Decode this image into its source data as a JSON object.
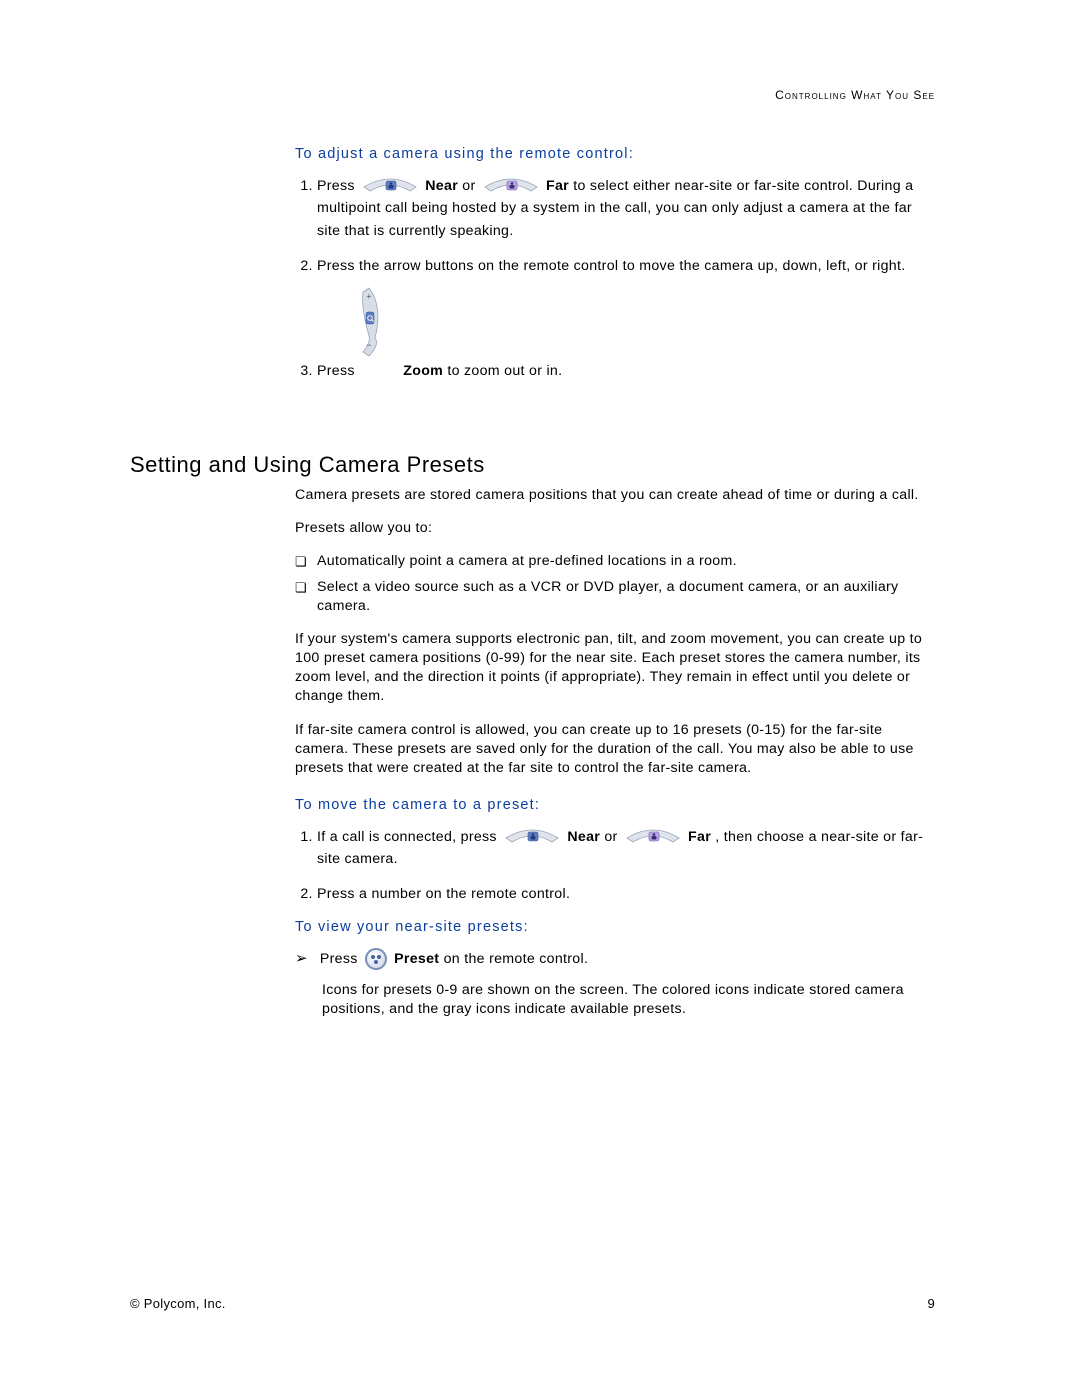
{
  "header": "Controlling What You See",
  "sec1": {
    "title": "To adjust a camera using the remote control:",
    "items": [
      {
        "pre": "Press ",
        "near": " Near",
        "mid": " or ",
        "far": " Far",
        "post": " to select either near-site or far-site control. During a multipoint call being hosted by a system in the call, you can only adjust a camera at the far site that is currently speaking."
      },
      {
        "text": "Press the arrow buttons on the remote control to move the camera up, down, left, or right."
      },
      {
        "pre": "Press ",
        "zoom": " Zoom",
        "post": " to zoom out or in."
      }
    ]
  },
  "section_head": "Setting and Using Camera Presets",
  "body": {
    "p1": "Camera presets are stored camera positions that you can create ahead of time or during a call.",
    "p2": "Presets allow you to:",
    "bullets": [
      "Automatically point a camera at pre-defined locations in a room.",
      "Select a video source such as a VCR or DVD player, a document camera, or an auxiliary camera."
    ],
    "p3": "If your system's camera supports electronic pan, tilt, and zoom movement, you can create up to 100 preset camera positions (0-99) for the near site. Each preset stores the camera number, its zoom level, and the direction it points (if appropriate). They remain in effect until you delete or change them.",
    "p4": "If far-site camera control is allowed, you can create up to 16 presets (0-15) for the far-site camera. These presets are saved only for the duration of the call. You may also be able to use presets that were created at the far site to control the far-site camera."
  },
  "sec2": {
    "title": "To move the camera to a preset:",
    "items": [
      {
        "pre": "If a call is connected, press ",
        "near": " Near",
        "mid": " or ",
        "far": " Far",
        "post": ", then choose a near-site or far-site camera."
      },
      {
        "text": "Press a number on the remote control."
      }
    ]
  },
  "sec3": {
    "title": "To view your near-site presets:",
    "line1_pre": "Press ",
    "line1_mid": " Preset",
    "line1_post": " on the remote control.",
    "line2": "Icons for presets 0-9 are shown on the screen. The colored icons indicate stored camera positions, and the gray icons indicate available presets."
  },
  "footer": {
    "left": "© Polycom, Inc.",
    "right": "9"
  }
}
